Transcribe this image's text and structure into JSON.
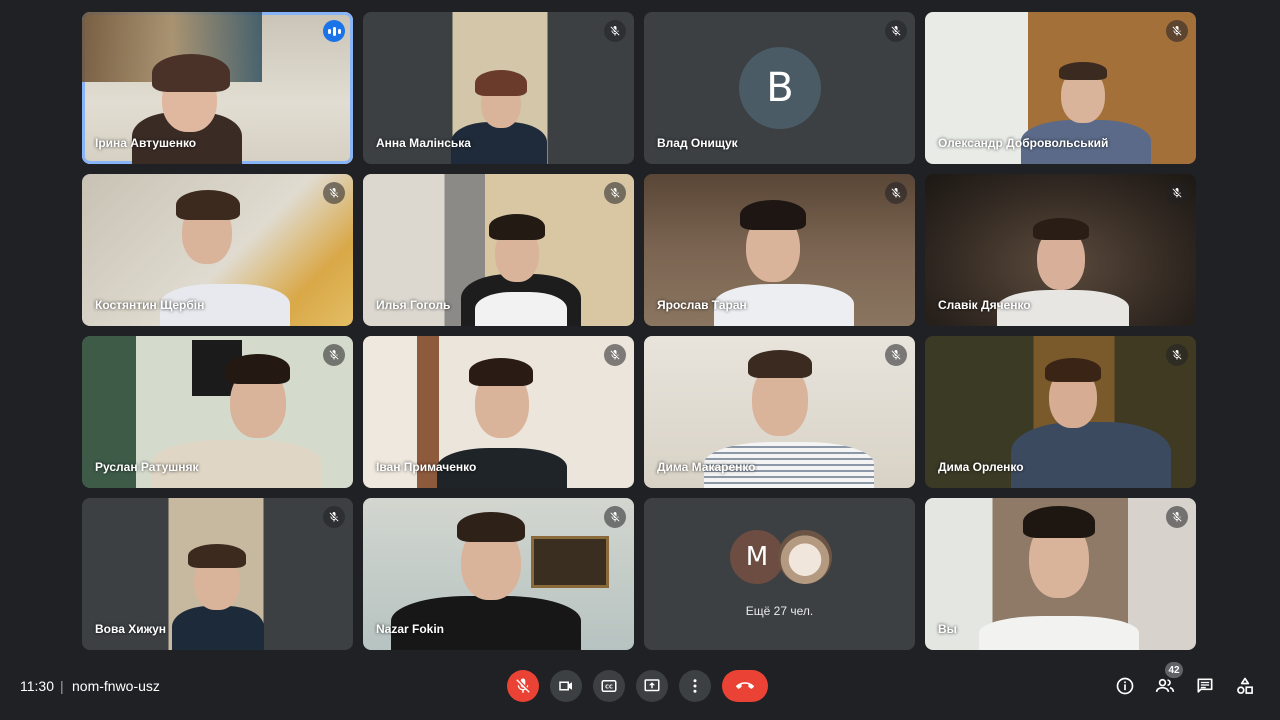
{
  "participants": [
    {
      "name": "Ірина Автушенко",
      "speaking": true
    },
    {
      "name": "Анна Малінська",
      "muted": true
    },
    {
      "name": "Влад Онищук",
      "muted": true,
      "initial": "B",
      "avatar_color": "#4a5b66"
    },
    {
      "name": "Олександр Добровольський",
      "muted": true
    },
    {
      "name": "Костянтин Щербін",
      "muted": true
    },
    {
      "name": "Илья Гоголь",
      "muted": true
    },
    {
      "name": "Ярослав Таран",
      "muted": true
    },
    {
      "name": "Славік Дяченко",
      "muted": true
    },
    {
      "name": "Руслан Ратушняк",
      "muted": true
    },
    {
      "name": "Іван Примаченко",
      "muted": true
    },
    {
      "name": "Дима Макаренко",
      "muted": true
    },
    {
      "name": "Дима Орленко",
      "muted": true
    },
    {
      "name": "Вова Хижун",
      "muted": true
    },
    {
      "name": "Nazar Fokin",
      "muted": true
    },
    {
      "name": "Вы",
      "muted": true
    }
  ],
  "more_tile": {
    "initial": "M",
    "avatar_color": "#6d4c41",
    "label": "Ещё 27 чел."
  },
  "meeting": {
    "time": "11:30",
    "separator": "|",
    "code": "nom-fnwo-usz"
  },
  "participant_count_badge": "42",
  "colors": {
    "background": "#202124",
    "tile": "#3c4043",
    "danger": "#ea4335",
    "speaking_outline": "#8ab4f8"
  },
  "controls": {
    "mic": "mic-off-icon",
    "camera": "camera-icon",
    "captions": "captions-icon",
    "present": "present-screen-icon",
    "more": "more-options-icon",
    "hangup": "hang-up-icon"
  },
  "right_controls": [
    "info-icon",
    "people-icon",
    "chat-icon",
    "activities-icon"
  ]
}
